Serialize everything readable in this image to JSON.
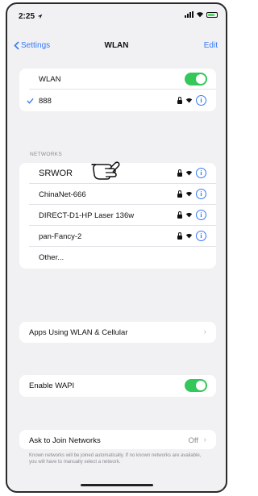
{
  "status_bar": {
    "time": "2:25"
  },
  "nav": {
    "back_label": "Settings",
    "title": "WLAN",
    "edit_label": "Edit"
  },
  "wlan_group": {
    "toggle_label": "WLAN",
    "toggle_on": true,
    "connected_network": "888"
  },
  "networks": {
    "header": "NETWORKS",
    "items": [
      {
        "name": "SRWOR"
      },
      {
        "name": "ChinaNet-666"
      },
      {
        "name": "DIRECT-D1-HP Laser 136w"
      },
      {
        "name": "pan-Fancy-2"
      }
    ],
    "other_label": "Other..."
  },
  "apps_using": {
    "label": "Apps Using WLAN & Cellular"
  },
  "wapi": {
    "label": "Enable WAPI",
    "toggle_on": true
  },
  "ask_join": {
    "label": "Ask to Join Networks",
    "value": "Off",
    "footnote": "Known networks will be joined automatically. If no known networks are available, you will have to manually select a network."
  },
  "colors": {
    "accent": "#3478f6",
    "toggle": "#34c759",
    "background": "#f1f1f4"
  },
  "icons": [
    "location-arrow-icon",
    "signal-icon",
    "wifi-icon",
    "battery-icon",
    "chevron-left-icon",
    "checkmark-icon",
    "lock-icon",
    "info-icon",
    "chevron-right-icon",
    "hand-pointer-icon"
  ]
}
